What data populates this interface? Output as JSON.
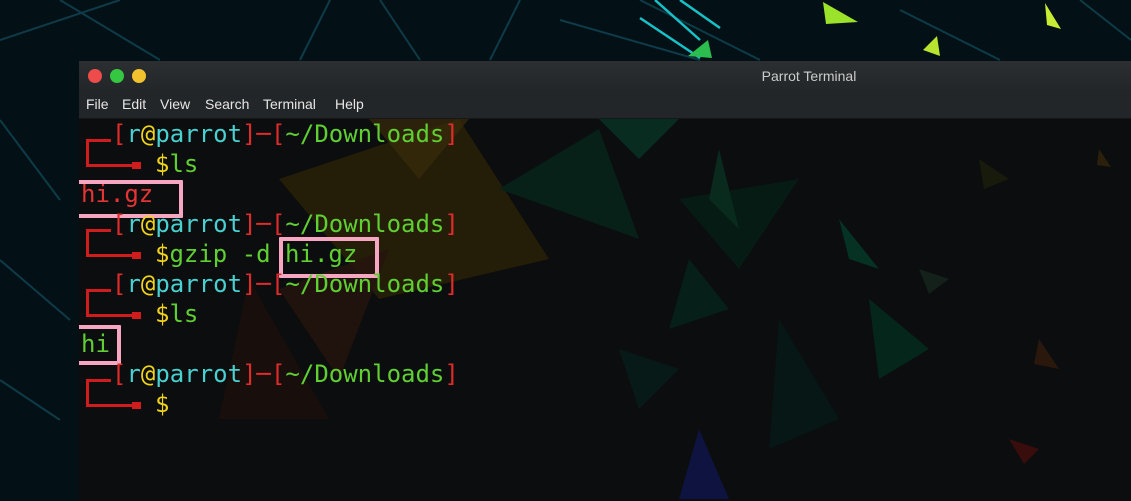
{
  "window": {
    "title": "Parrot Terminal"
  },
  "menu": [
    "File",
    "Edit",
    "View",
    "Search",
    "Terminal",
    "Help"
  ],
  "prompt": {
    "open": "[",
    "user": "r",
    "at": "@",
    "host": "parrot",
    "close": "]",
    "sep": "─",
    "dir": "~/Downloads",
    "dollar": "$"
  },
  "commands": [
    {
      "cmd": "ls",
      "output": "hi.gz"
    },
    {
      "cmd": "gzip -d ",
      "arg": "hi.gz"
    },
    {
      "cmd": "ls",
      "output": "hi"
    },
    {
      "cmd": ""
    }
  ]
}
